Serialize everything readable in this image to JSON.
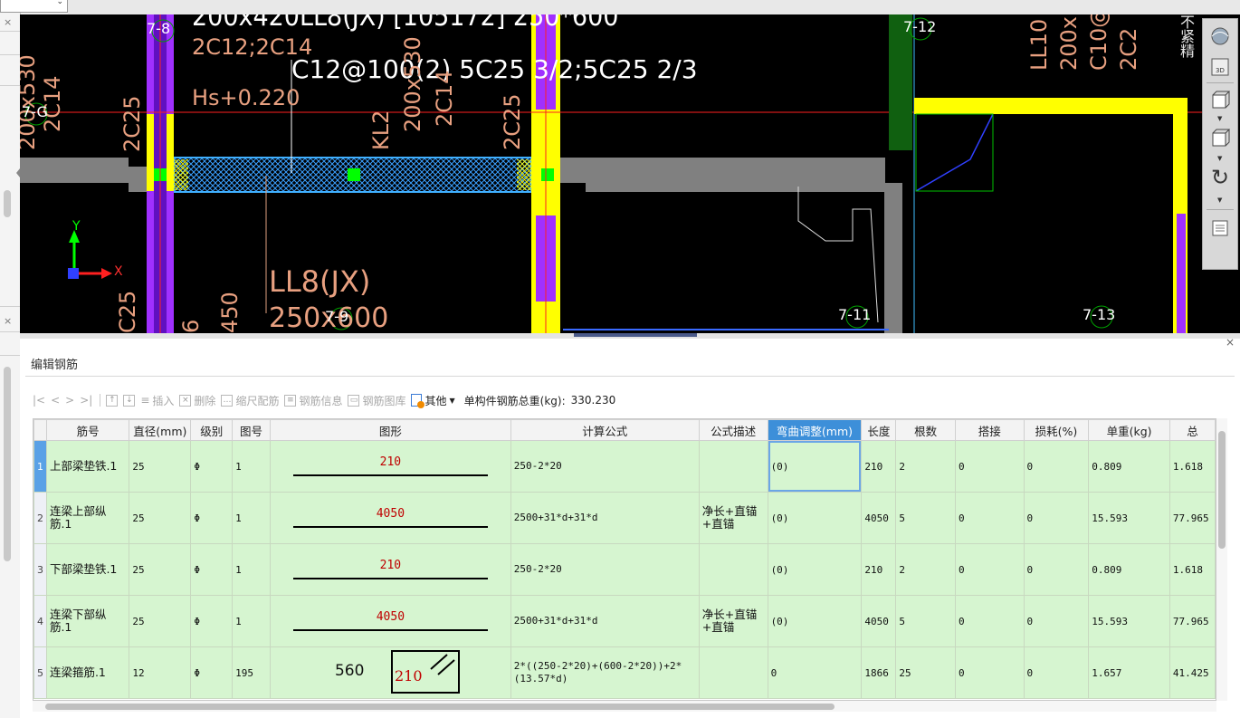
{
  "viewport": {
    "axis_names": [
      "7-G",
      "7-8",
      "7-9",
      "7-12",
      "7-11",
      "7-13"
    ],
    "beam_annotations": {
      "top_line1": "200x420LL8(JX) [105172] 250*600",
      "top_line2": "2C12;2C14",
      "top_line3": "C12@100(2) 5C25 3/2;5C25 2/3",
      "elevation": "Hs+0.220",
      "left_vert1": "200x530",
      "left_vert2": "2C14",
      "left_vert3": "2C25",
      "mid_vert1": "KL2",
      "mid_vert2": "200x530",
      "mid_vert3": "2C14",
      "mid_vert4": "2C25",
      "right_vert1": "LL10",
      "right_vert2": "200x",
      "right_vert3": "C10@",
      "right_vert4": "2C2",
      "bottom_label1": "LL8(JX)",
      "bottom_label2": "250x600",
      "bottom_left1": "C25",
      "bottom_left2": "6",
      "bottom_left3": "450",
      "far_right_text": "不紧精"
    },
    "axis_x": "X",
    "axis_y": "Y",
    "toolbar_icons": [
      "globe-icon",
      "3d-view-icon",
      "cube-front-icon",
      "cube-iso-icon",
      "rotate-icon",
      "layers-icon"
    ]
  },
  "editor": {
    "title": "编辑钢筋",
    "toolbar": {
      "nav": [
        "|<",
        "<",
        ">",
        ">|"
      ],
      "move_up": "↑",
      "move_down": "↓",
      "insert": "插入",
      "delete": "删除",
      "scale_rebar": "缩尺配筋",
      "rebar_info": "钢筋信息",
      "rebar_library": "钢筋图库",
      "other": "其他",
      "total_label": "单构件钢筋总重(kg):",
      "total_value": "330.230"
    },
    "columns": [
      "筋号",
      "直径(mm)",
      "级别",
      "图号",
      "图形",
      "计算公式",
      "公式描述",
      "弯曲调整(mm)",
      "长度",
      "根数",
      "搭接",
      "损耗(%)",
      "单重(kg)",
      "总"
    ],
    "rows": [
      {
        "num": "1",
        "name": "上部梁垫铁.1",
        "dia": "25",
        "grade": "Φ",
        "fig": "1",
        "shape": "210",
        "formula": "250-2*20",
        "desc": "",
        "bend": "(0)",
        "length": "210",
        "count": "2",
        "lap": "0",
        "loss": "0",
        "unit_wt": "0.809",
        "total": "1.618"
      },
      {
        "num": "2",
        "name": "连梁上部纵筋.1",
        "dia": "25",
        "grade": "Φ",
        "fig": "1",
        "shape": "4050",
        "formula": "2500+31*d+31*d",
        "desc": "净长+直锚+直锚",
        "bend": "(0)",
        "length": "4050",
        "count": "5",
        "lap": "0",
        "loss": "0",
        "unit_wt": "15.593",
        "total": "77.965"
      },
      {
        "num": "3",
        "name": "下部梁垫铁.1",
        "dia": "25",
        "grade": "Φ",
        "fig": "1",
        "shape": "210",
        "formula": "250-2*20",
        "desc": "",
        "bend": "(0)",
        "length": "210",
        "count": "2",
        "lap": "0",
        "loss": "0",
        "unit_wt": "0.809",
        "total": "1.618"
      },
      {
        "num": "4",
        "name": "连梁下部纵筋.1",
        "dia": "25",
        "grade": "Φ",
        "fig": "1",
        "shape": "4050",
        "formula": "2500+31*d+31*d",
        "desc": "净长+直锚+直锚",
        "bend": "(0)",
        "length": "4050",
        "count": "5",
        "lap": "0",
        "loss": "0",
        "unit_wt": "15.593",
        "total": "77.965"
      },
      {
        "num": "5",
        "name": "连梁箍筋.1",
        "dia": "12",
        "grade": "Φ",
        "fig": "195",
        "shape_a": "560",
        "shape_b": "210",
        "formula": "2*((250-2*20)+(600-2*20))+2*(13.57*d)",
        "desc": "",
        "bend": "0",
        "length": "1866",
        "count": "25",
        "lap": "0",
        "loss": "0",
        "unit_wt": "1.657",
        "total": "41.425"
      }
    ]
  },
  "colors": {
    "row_bg": "#d6f5d0",
    "highlight_header": "#3d8fd9",
    "selected_row_num": "#5aa1e6",
    "cad_background": "#000000",
    "cad_yellow": "#ffff00",
    "cad_purple": "#a030ff"
  }
}
